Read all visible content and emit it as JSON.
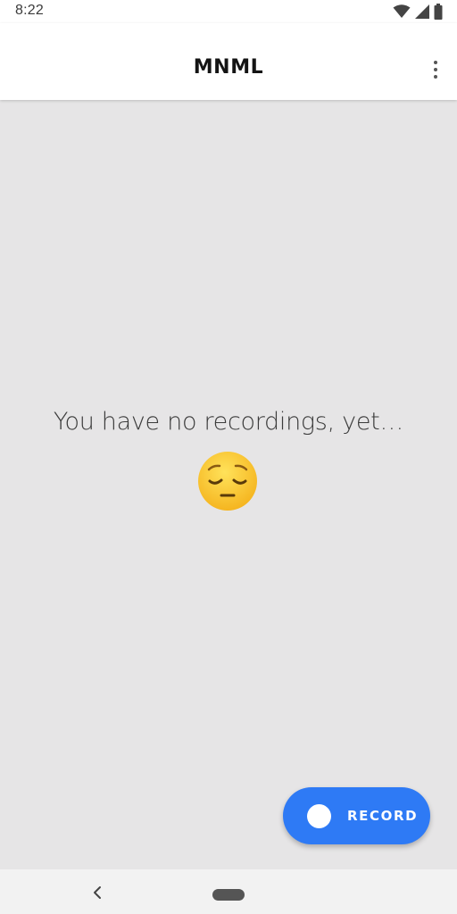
{
  "status_bar": {
    "time": "8:22",
    "icons": [
      "wifi-icon",
      "cellular-signal-icon",
      "battery-icon"
    ]
  },
  "app_bar": {
    "title": "MNML",
    "menu_icon": "more-vert-icon"
  },
  "empty_state": {
    "message": "You have no recordings, yet…",
    "emoji": "pensive-face-emoji"
  },
  "record_button": {
    "label": "RECORD",
    "color": "#2e7af5"
  },
  "nav_bar": {
    "icons": [
      "back-icon",
      "home-pill-icon"
    ]
  }
}
